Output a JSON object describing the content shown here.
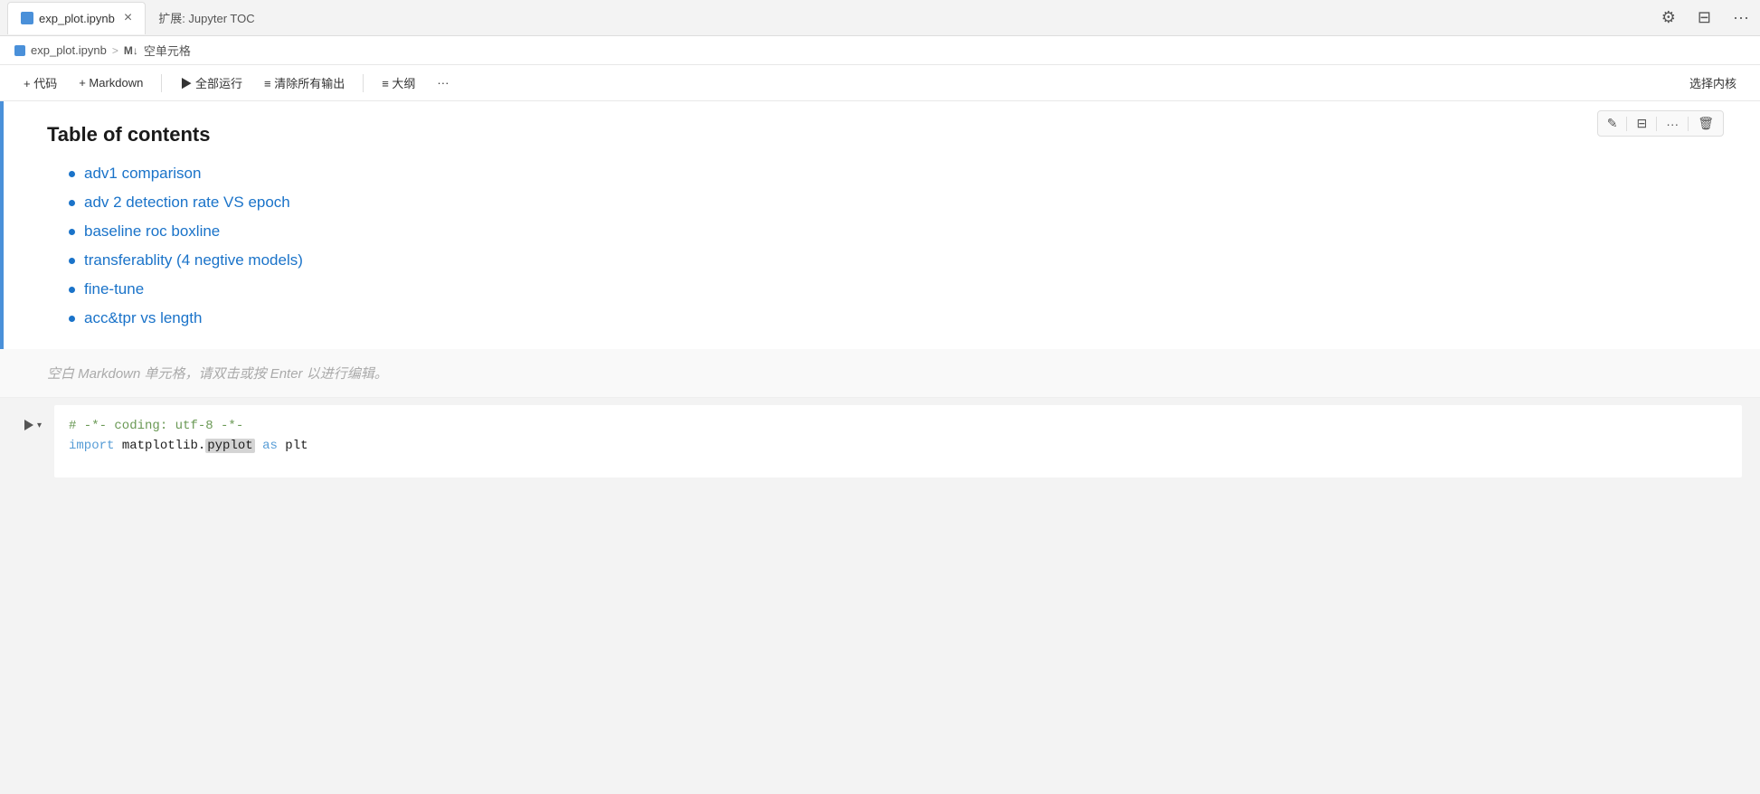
{
  "tab": {
    "active_label": "exp_plot.ipynb",
    "inactive_label": "扩展: Jupyter TOC",
    "close_symbol": "×"
  },
  "breadcrumb": {
    "file": "exp_plot.ipynb",
    "separator": ">",
    "cell_type": "M↓",
    "cell_label": "空单元格"
  },
  "toolbar": {
    "add_code": "+ 代码",
    "add_markdown": "+ Markdown",
    "run_all": "▶ 全部运行",
    "clear_output": "≡ 清除所有输出",
    "outline": "≡ 大纲",
    "more": "···",
    "select_kernel": "选择内核"
  },
  "cell_toolbar": {
    "edit": "✎",
    "split": "⊟",
    "more": "···",
    "delete": "🗑"
  },
  "toc": {
    "heading": "Table of contents",
    "items": [
      "adv1 comparison",
      "adv 2 detection rate VS epoch",
      "baseline roc boxline",
      "transferablity (4 negtive models)",
      "fine-tune",
      "acc&tpr vs length"
    ]
  },
  "empty_md": {
    "placeholder": "空白 Markdown 单元格，请双击或按 Enter 以进行编辑。"
  },
  "code_cell": {
    "line1": "# -*- coding: utf-8 -*-",
    "line2_keyword": "import",
    "line2_module": "matplotlib.pyplot",
    "line2_highlight": "pyplot",
    "line2_as": "as",
    "line2_alias": "plt"
  },
  "icons": {
    "settings": "⚙",
    "split_editor": "⊟",
    "more": "···"
  }
}
